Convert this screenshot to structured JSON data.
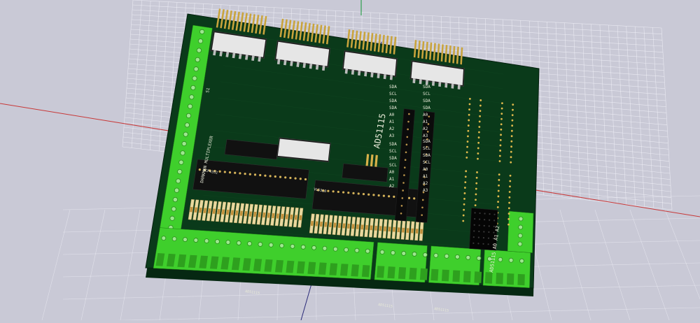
{
  "viewer": {
    "background_color": "#c9c9d6",
    "grid_color": "#f4f4fb",
    "axis_x_color": "#c83838",
    "axis_y_color": "#2e9e4e",
    "axis_z_color": "#2a2a78"
  },
  "board": {
    "solder_mask_color": "#0a3a1a",
    "edge_color": "#062812",
    "silk_color": "#e8ead8",
    "terminal_color": "#3fcf2c",
    "labels": {
      "chip_label": "AD51115",
      "side_label": "DARKMAN MULTIPLEXER",
      "s1_label": "S1",
      "mcp_label": "MCP4352",
      "vl53_label": "VL53L0",
      "addr_label": "AD51115 A0 A1 A2",
      "bottom_label_1": "AD51115",
      "bottom_label_2": "AD51115",
      "bottom_label_3": "AD51115"
    },
    "pin_labels_left": [
      "SDA",
      "SCL",
      "SDA",
      "SDA",
      "A0",
      "A1",
      "A2",
      "A3"
    ],
    "pin_labels_right": [
      "SDA",
      "SCL",
      "SDA",
      "SDA",
      "A0",
      "A1",
      "A2",
      "A3"
    ],
    "pin_labels_left_2": [
      "SDA",
      "SCL",
      "SDA",
      "SCL",
      "A0",
      "A1",
      "A2"
    ],
    "pin_labels_right_2": [
      "SDA",
      "SCL",
      "SDA",
      "SCL",
      "A0",
      "A1",
      "A2",
      "A3"
    ]
  }
}
